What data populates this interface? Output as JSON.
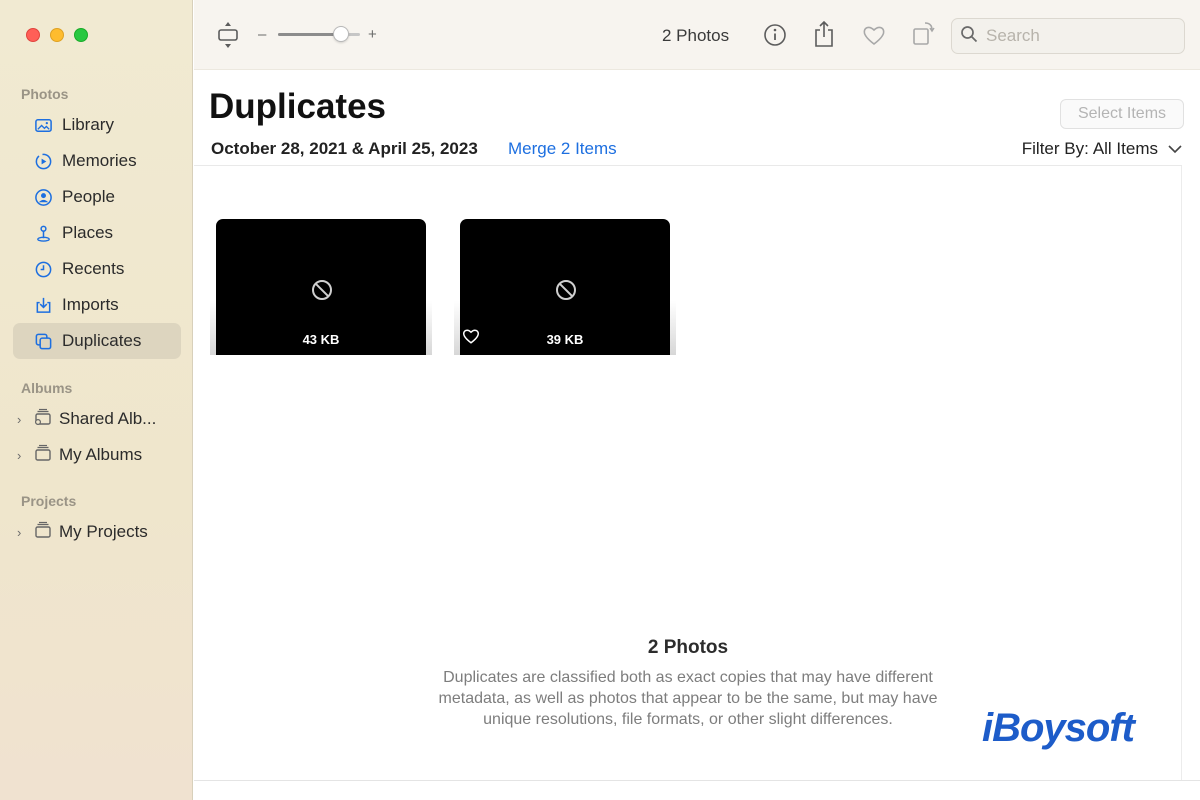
{
  "sidebar": {
    "sections": {
      "photos": "Photos",
      "albums": "Albums",
      "projects": "Projects"
    },
    "items": [
      {
        "label": "Library",
        "icon": "library-icon"
      },
      {
        "label": "Memories",
        "icon": "memories-icon"
      },
      {
        "label": "People",
        "icon": "people-icon"
      },
      {
        "label": "Places",
        "icon": "places-icon"
      },
      {
        "label": "Recents",
        "icon": "recents-icon"
      },
      {
        "label": "Imports",
        "icon": "imports-icon"
      },
      {
        "label": "Duplicates",
        "icon": "duplicates-icon",
        "active": true
      }
    ],
    "albums": [
      {
        "label": "Shared Alb...",
        "icon": "shared-album-icon"
      },
      {
        "label": "My Albums",
        "icon": "album-stack-icon"
      }
    ],
    "projects": [
      {
        "label": "My Projects",
        "icon": "project-stack-icon"
      }
    ]
  },
  "toolbar": {
    "zoom_minus": "–",
    "zoom_plus": "+",
    "zoom_level": 0.75,
    "photo_count": "2 Photos",
    "search_placeholder": "Search"
  },
  "main": {
    "title": "Duplicates",
    "select_items": "Select Items",
    "date_range": "October 28, 2021 & April 25, 2023",
    "merge_label": "Merge 2 Items",
    "filter_label": "Filter By:",
    "filter_value": "All Items",
    "thumbnails": [
      {
        "size": "43 KB",
        "favorited": false
      },
      {
        "size": "39 KB",
        "favorited": true
      }
    ],
    "info_title": "2 Photos",
    "info_text": "Duplicates are classified both as exact copies that may have different metadata, as well as photos that appear to be the same, but may have unique resolutions, file formats, or other slight differences."
  },
  "watermark": "iBoysoft",
  "colors": {
    "accent": "#1d6fe0",
    "sidebar_bg": "#f1ead2",
    "logo": "#1d5cc9"
  }
}
